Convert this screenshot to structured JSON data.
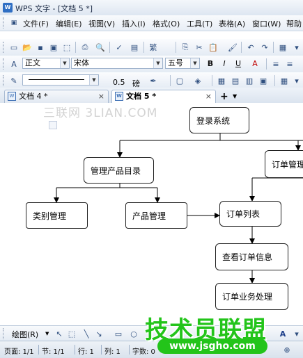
{
  "window": {
    "title": "WPS 文字 - [文档 5 *]",
    "app_icon": "W"
  },
  "menu": [
    "文件(F)",
    "编辑(E)",
    "视图(V)",
    "插入(I)",
    "格式(O)",
    "工具(T)",
    "表格(A)",
    "窗口(W)",
    "帮助"
  ],
  "format_toolbar": {
    "style": "正文",
    "font": "宋体",
    "size": "五号",
    "bold": "B",
    "italic": "I",
    "underline": "U",
    "font_color": "A"
  },
  "draw_format_toolbar": {
    "line_width": "0.5",
    "unit": "磅"
  },
  "tabs": [
    {
      "label": "文档 4 *",
      "active": false
    },
    {
      "label": "文档 5 *",
      "active": true
    }
  ],
  "tab_add": "+",
  "watermark": "三联网 3LIAN.COM",
  "diagram": {
    "nodes": [
      "登录系统",
      "管理产品目录",
      "订单管理",
      "类别管理",
      "产品管理",
      "订单列表",
      "查看订单信息",
      "订单业务处理"
    ]
  },
  "drawing_toolbar": {
    "label": "绘图(R)"
  },
  "status": {
    "page": "页面: 1/1",
    "section": "节: 1/1",
    "row": "行: 1",
    "col": "列: 1",
    "chars": "字数: 0"
  },
  "overlay_logo": {
    "text": "技术员联盟",
    "url": "www.jsgho.com"
  }
}
